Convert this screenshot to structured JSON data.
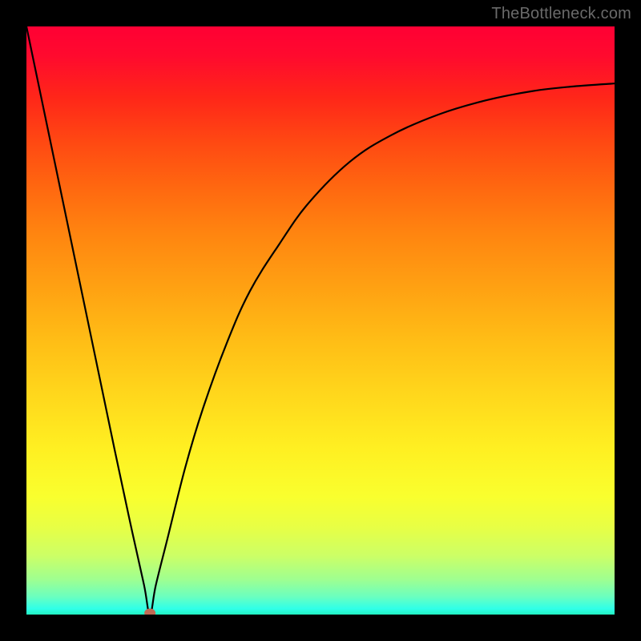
{
  "watermark": "TheBottleneck.com",
  "chart_data": {
    "type": "line",
    "title": "",
    "xlabel": "",
    "ylabel": "",
    "xlim": [
      0,
      100
    ],
    "ylim": [
      0,
      100
    ],
    "grid": false,
    "legend": false,
    "annotations": [],
    "min_marker": {
      "x": 21,
      "y": 0
    },
    "background_gradient": {
      "top": "#ff0034",
      "bottom": "#22f2c2"
    },
    "series": [
      {
        "name": "curve",
        "x": [
          0,
          5,
          10,
          15,
          18,
          20,
          21,
          22,
          24,
          27,
          30,
          34,
          38,
          43,
          48,
          55,
          62,
          70,
          78,
          86,
          93,
          100
        ],
        "y": [
          100,
          76,
          52,
          28,
          14,
          5,
          0,
          5,
          13,
          25,
          35,
          46,
          55,
          63,
          70,
          77,
          81.5,
          85,
          87.4,
          89,
          89.8,
          90.3
        ]
      }
    ]
  },
  "colors": {
    "frame": "#000000",
    "curve": "#000000",
    "dot": "#c06a55",
    "watermark": "#6a6a6a"
  }
}
